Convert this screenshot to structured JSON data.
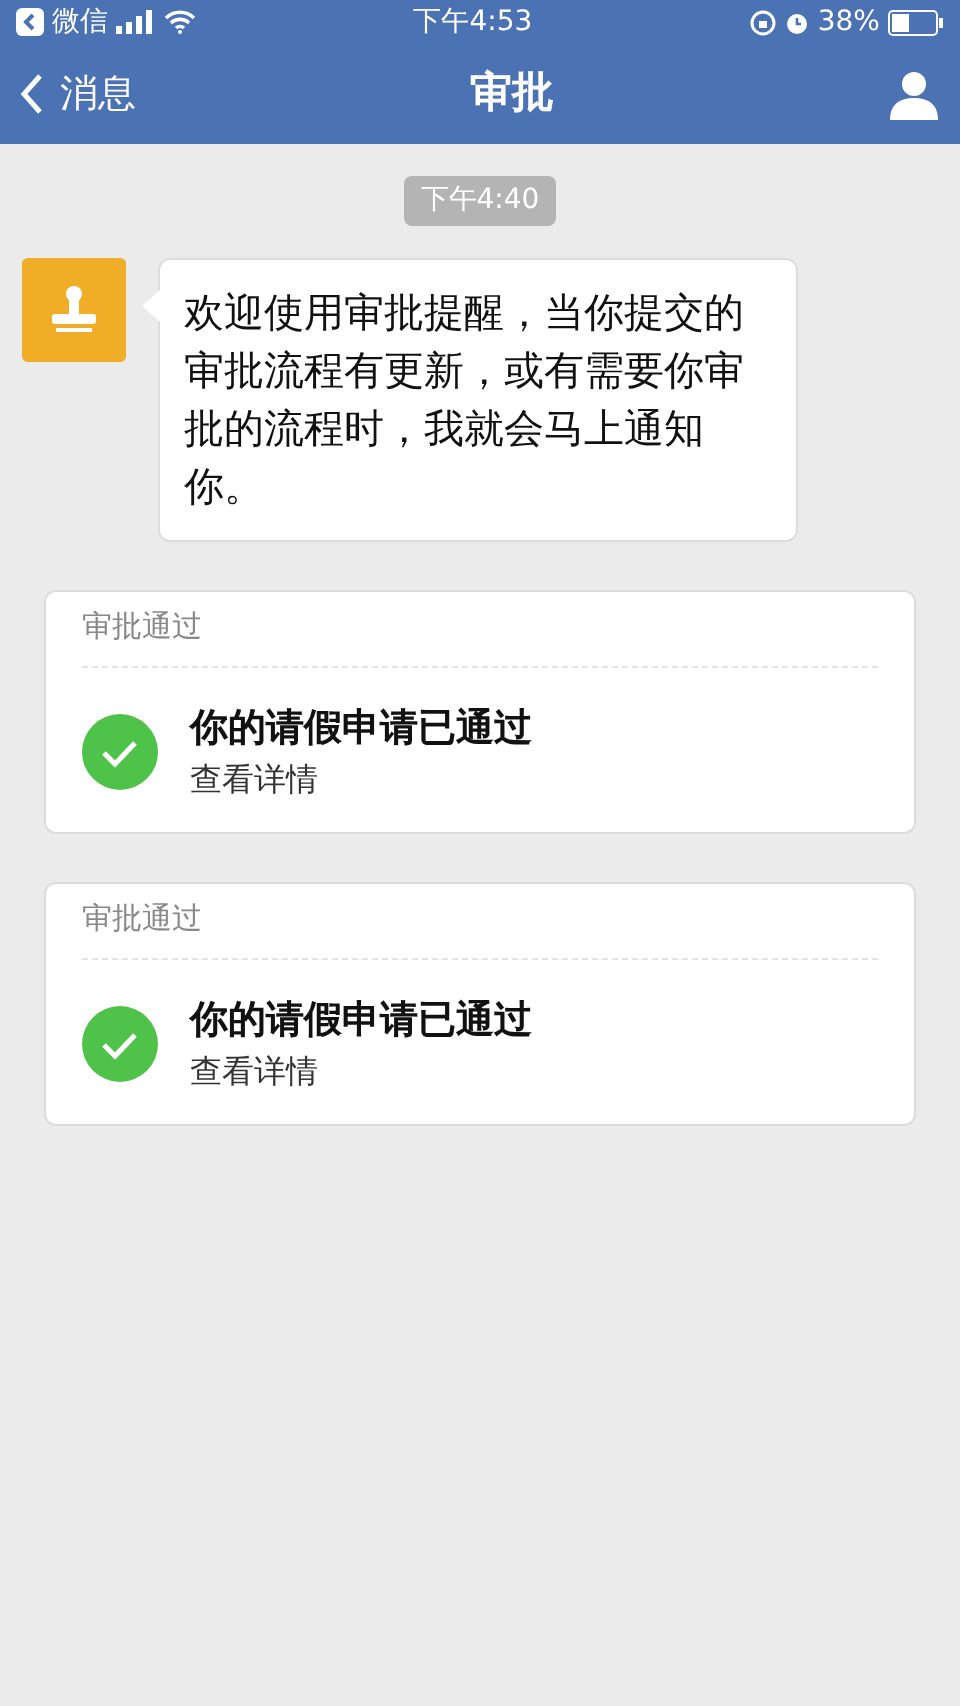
{
  "status_bar": {
    "back_app": "微信",
    "time": "下午4:53",
    "battery": "38%"
  },
  "nav": {
    "back": "消息",
    "title": "审批"
  },
  "timestamp": "下午4:40",
  "message": {
    "text": "欢迎使用审批提醒，当你提交的审批流程有更新，或有需要你审批的流程时，我就会马上通知你。"
  },
  "cards": [
    {
      "header": "审批通过",
      "title": "你的请假申请已通过",
      "link": "查看详情"
    },
    {
      "header": "审批通过",
      "title": "你的请假申请已通过",
      "link": "查看详情"
    }
  ]
}
